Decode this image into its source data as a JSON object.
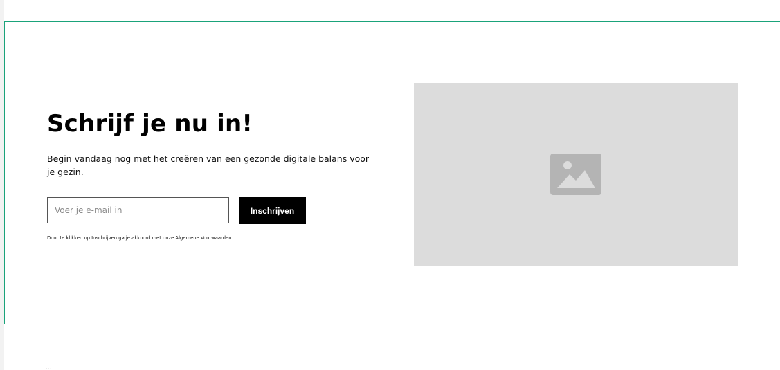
{
  "signup": {
    "heading": "Schrijf je nu in!",
    "description": "Begin vandaag nog met het creëren van een gezonde digitale balans voor je gezin.",
    "email_placeholder": "Voer je e-mail in",
    "email_value": "",
    "submit_label": "Inschrijven",
    "terms_text": "Door te klikken op Inschrijven ga je akkoord met onze Algemene Voorwaarden."
  },
  "image": {
    "icon": "image-placeholder-icon"
  },
  "footer": {
    "fragment": "..."
  },
  "colors": {
    "section_border": "#1aa37a",
    "button_bg": "#000000",
    "placeholder_bg": "#dcdcdc",
    "icon_color": "#b4b4b4"
  }
}
